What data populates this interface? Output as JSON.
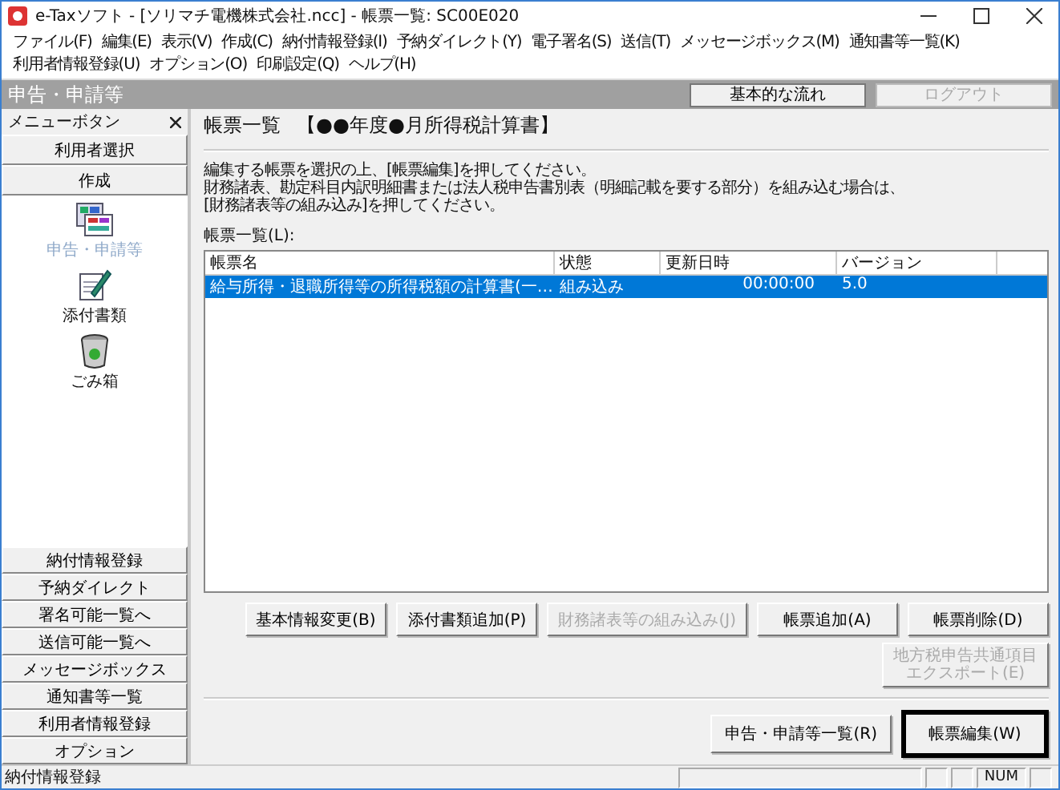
{
  "window": {
    "title": "e-Taxソフト - [ソリマチ電機株式会社.ncc] - 帳票一覧: SC00E020"
  },
  "menu": [
    "ファイル(F)",
    "編集(E)",
    "表示(V)",
    "作成(C)",
    "納付情報登録(I)",
    "予納ダイレクト(Y)",
    "電子署名(S)",
    "送信(T)",
    "メッセージボックス(M)",
    "通知書等一覧(K)",
    "利用者情報登録(U)",
    "オプション(O)",
    "印刷設定(Q)",
    "ヘルプ(H)"
  ],
  "header": {
    "title": "申告・申請等",
    "buttons": [
      {
        "label": "基本的な流れ",
        "disabled": false
      },
      {
        "label": "ログアウト",
        "disabled": true
      }
    ]
  },
  "sidebar": {
    "title": "メニューボタン",
    "top_buttons": [
      "利用者選択",
      "作成"
    ],
    "tools": [
      {
        "label": "申告・申請等",
        "selected": true,
        "kind": "forms"
      },
      {
        "label": "添付書類",
        "selected": false,
        "kind": "attach"
      },
      {
        "label": "ごみ箱",
        "selected": false,
        "kind": "trash"
      }
    ],
    "bottom_buttons": [
      "納付情報登録",
      "予納ダイレクト",
      "署名可能一覧へ",
      "送信可能一覧へ",
      "メッセージボックス",
      "通知書等一覧",
      "利用者情報登録",
      "オプション"
    ]
  },
  "main": {
    "title": "帳票一覧",
    "subtitle": "【●●年度●月所得税計算書】",
    "instructions": [
      "編集する帳票を選択の上、[帳票編集]を押してください。",
      "財務諸表、勘定科目内訳明細書または法人税申告書別表（明細記載を要する部分）を組み込む場合は、",
      "[財務諸表等の組み込み]を押してください。"
    ],
    "list_label": "帳票一覧(L):",
    "table": {
      "columns": [
        "帳票名",
        "状態",
        "更新日時",
        "バージョン"
      ],
      "rows": [
        {
          "cells": [
            "給与所得・退職所得等の所得税額の計算書(一…",
            "組み込み",
            "00:00:00",
            "5.0"
          ],
          "selected": true
        }
      ]
    },
    "action_buttons": [
      {
        "label": "基本情報変更(B)",
        "disabled": false
      },
      {
        "label": "添付書類追加(P)",
        "disabled": false
      },
      {
        "label": "財務諸表等の組み込み(J)",
        "disabled": true
      },
      {
        "label": "帳票追加(A)",
        "disabled": false
      },
      {
        "label": "帳票削除(D)",
        "disabled": false
      }
    ],
    "export_button": {
      "lines": [
        "地方税申告共通項目",
        "エクスポート(E)"
      ],
      "disabled": true
    },
    "footer_buttons": [
      {
        "label": "申告・申請等一覧(R)",
        "default": false
      },
      {
        "label": "帳票編集(W)",
        "default": true
      }
    ]
  },
  "status_bar": {
    "message": "納付情報登録",
    "indicators": [
      "NUM"
    ]
  }
}
